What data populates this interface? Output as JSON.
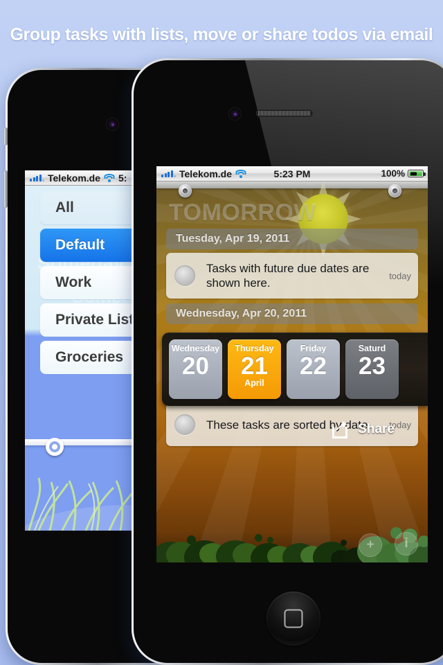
{
  "headline": "Group tasks with lists, move or share todos via email",
  "accent_colors": {
    "background": "#b4c6f2",
    "selected_list": "#1573e8",
    "picker_highlight": "#f59a06",
    "app_sky": "#b5761a"
  },
  "back_phone": {
    "status_bar": {
      "carrier": "Telekom.de",
      "signal_icon": "signal-bars-icon",
      "wifi_icon": "wifi-icon",
      "time": "5:"
    },
    "ghost_text_1": "Someday",
    "ghost_text_2": "Someday be",
    "lists": [
      {
        "label": "All",
        "selected": false
      },
      {
        "label": "Default",
        "selected": true
      },
      {
        "label": "Work",
        "selected": false
      },
      {
        "label": "Private List",
        "selected": false
      },
      {
        "label": "Groceries",
        "selected": false
      }
    ]
  },
  "front_phone": {
    "status_bar": {
      "carrier": "Telekom.de",
      "signal_icon": "signal-bars-icon",
      "wifi_icon": "wifi-icon",
      "time": "5:23 PM",
      "battery_percent": "100%",
      "battery_icon": "battery-charging-icon"
    },
    "app": {
      "hero_title": "TOMORROW",
      "sun_icon": "sun-icon",
      "sections": [
        {
          "header": "Tuesday, Apr 19, 2011",
          "tasks": [
            {
              "text": "Tasks with future due dates are shown here.",
              "tag": "today",
              "checkbox": "unchecked-circle-icon"
            }
          ]
        },
        {
          "header": "Wednesday, Apr 20, 2011",
          "tasks": [
            {
              "text": "These tasks are sorted by date.",
              "tag": "today",
              "checkbox": "unchecked-circle-icon"
            }
          ]
        }
      ],
      "date_picker": {
        "days": [
          {
            "weekday": "Wednesday",
            "number": "20",
            "month": "",
            "state": "normal"
          },
          {
            "weekday": "Thursday",
            "number": "21",
            "month": "April",
            "state": "selected"
          },
          {
            "weekday": "Friday",
            "number": "22",
            "month": "",
            "state": "normal"
          },
          {
            "weekday": "Saturd",
            "number": "23",
            "month": "",
            "state": "dimmed"
          }
        ]
      },
      "share_overlay": {
        "label": "Share",
        "icon": "share-box-arrow-icon"
      },
      "toolbar": {
        "add_label": "+",
        "info_label": "i"
      }
    }
  }
}
